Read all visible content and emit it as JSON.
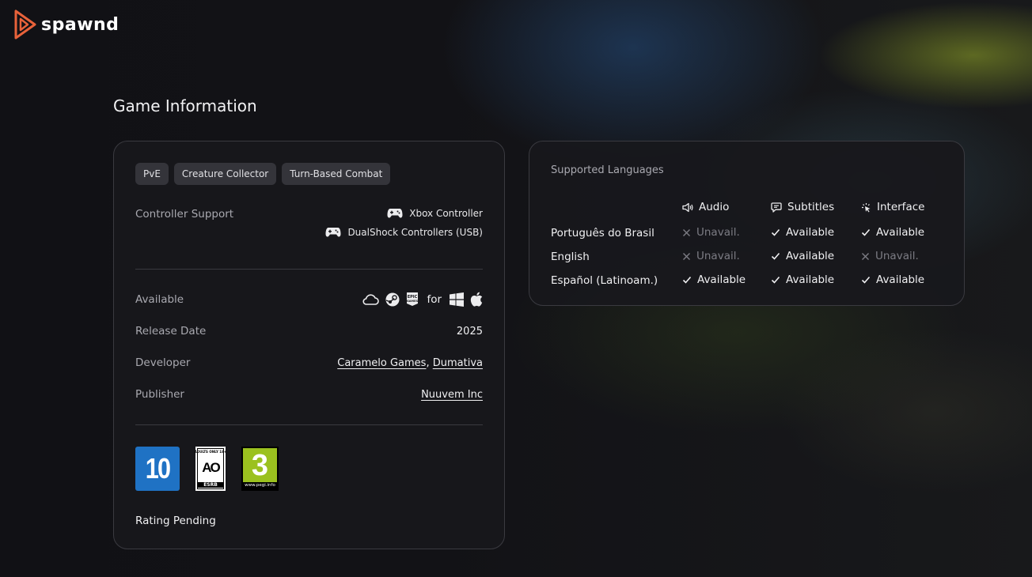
{
  "brand": {
    "name": "spawnd",
    "accent": "#e8623a"
  },
  "page": {
    "title": "Game Information"
  },
  "tags": [
    "PvE",
    "Creature Collector",
    "Turn-Based Combat"
  ],
  "controller": {
    "label": "Controller Support",
    "items": [
      {
        "icon": "gamepad-icon",
        "name": "Xbox Controller"
      },
      {
        "icon": "gamepad-icon",
        "name": "DualShock Controllers (USB)"
      }
    ]
  },
  "details": {
    "available_label": "Available",
    "available_for": "for",
    "stores": [
      "cloud-icon",
      "steam-icon",
      "epic-games-icon"
    ],
    "platforms": [
      "windows-icon",
      "apple-icon"
    ],
    "release_label": "Release Date",
    "release_value": "2025",
    "developer_label": "Developer",
    "developers": [
      "Caramelo Games",
      "Dumativa"
    ],
    "developer_separator": ",",
    "publisher_label": "Publisher",
    "publisher": "Nuuvem Inc"
  },
  "ratings": {
    "badges": [
      {
        "icon": "classind-10-icon",
        "text": "10",
        "color": "#1f72c4"
      },
      {
        "icon": "esrb-adults-only-icon",
        "top": "ADULTS ONLY 18+",
        "mark": "AO",
        "bottom": "ESRB"
      },
      {
        "icon": "pegi-3-icon",
        "text": "3",
        "footer": "www.pegi.info",
        "color": "#9bc11f"
      }
    ],
    "status": "Rating Pending"
  },
  "languages": {
    "title": "Supported Languages",
    "columns": [
      {
        "icon": "speaker-icon",
        "label": "Audio"
      },
      {
        "icon": "speech-bubble-icon",
        "label": "Subtitles"
      },
      {
        "icon": "interface-pointer-icon",
        "label": "Interface"
      }
    ],
    "rows": [
      {
        "name": "Português do Brasil",
        "values": [
          "Unavail.",
          "Available",
          "Available"
        ]
      },
      {
        "name": "English",
        "values": [
          "Unavail.",
          "Available",
          "Unavail."
        ]
      },
      {
        "name": "Español (Latinoam.)",
        "values": [
          "Available",
          "Available",
          "Available"
        ]
      }
    ]
  }
}
